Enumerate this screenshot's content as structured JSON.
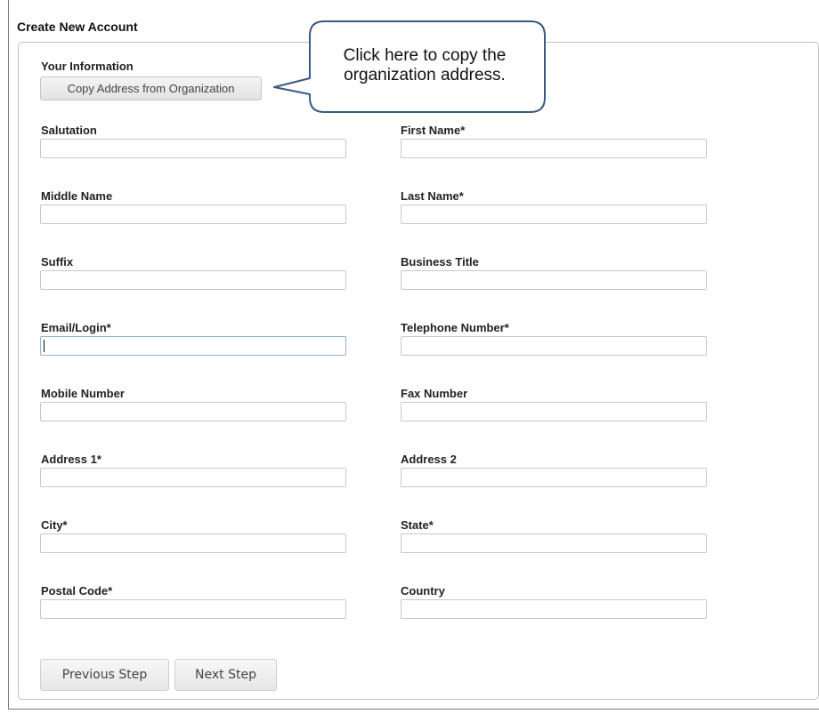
{
  "page": {
    "title": "Create New Account"
  },
  "section": {
    "label": "Your Information"
  },
  "copy_button": {
    "label": "Copy Address from Organization"
  },
  "callout": {
    "line1": "Click here to copy the",
    "line2": "organization address."
  },
  "fields": {
    "salutation": "Salutation",
    "first_name": "First Name*",
    "middle_name": "Middle Name",
    "last_name": "Last Name*",
    "suffix": "Suffix",
    "business_title": "Business Title",
    "email_login": "Email/Login*",
    "telephone": "Telephone Number*",
    "mobile": "Mobile Number",
    "fax": "Fax Number",
    "address1": "Address 1*",
    "address2": "Address 2",
    "city": "City*",
    "state": "State*",
    "postal_code": "Postal Code*",
    "country": "Country"
  },
  "buttons": {
    "previous": "Previous Step",
    "next": "Next Step"
  }
}
